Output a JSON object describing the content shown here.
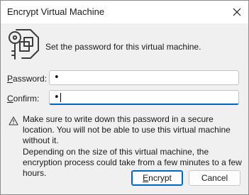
{
  "window": {
    "title": "Encrypt Virtual Machine"
  },
  "header": {
    "intro": "Set the password for this virtual machine.",
    "icon": "key-lock-icon"
  },
  "form": {
    "password": {
      "label_first": "P",
      "label_rest": "assword:",
      "value": "•"
    },
    "confirm": {
      "label_first": "C",
      "label_rest": "onfirm:",
      "value": "•"
    }
  },
  "notes": {
    "warning": "Make sure to write down this password in a secure location. You will not be able to use this virtual machine without it.",
    "info": "Depending on the size of this virtual machine, the encryption process could take from a few minutes to a few hours."
  },
  "buttons": {
    "encrypt_first": "E",
    "encrypt_rest": "ncrypt",
    "cancel": "Cancel"
  },
  "colors": {
    "accent": "#0067c0",
    "dialog_bg": "#f0f0f0",
    "titlebar_bg": "#ffffff",
    "icon_stroke": "#3c3c3c"
  }
}
